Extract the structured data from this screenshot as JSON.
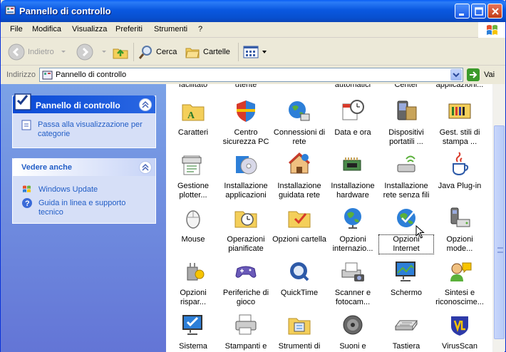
{
  "window": {
    "title": "Pannello di controllo"
  },
  "menu": [
    "File",
    "Modifica",
    "Visualizza",
    "Preferiti",
    "Strumenti",
    "?"
  ],
  "toolbar": {
    "back": "Indietro",
    "search": "Cerca",
    "folders": "Cartelle"
  },
  "address": {
    "label": "Indirizzo",
    "value": "Pannello di controllo",
    "go": "Vai"
  },
  "sidebar": {
    "panel1": {
      "title": "Pannello di controllo",
      "link": "Passa alla visualizzazione per categorie"
    },
    "panel2": {
      "title": "Vedere anche",
      "links": [
        "Windows Update",
        "Guida in linea e supporto tecnico"
      ]
    }
  },
  "partial_row": [
    "facilitato",
    "utente",
    "",
    "automatici",
    "Center",
    "applicazioni..."
  ],
  "items": [
    {
      "label": "Caratteri",
      "icon": "fonts-folder-icon"
    },
    {
      "label": "Centro sicurezza PC",
      "icon": "security-shield-icon"
    },
    {
      "label": "Connessioni di rete",
      "icon": "network-globe-icon"
    },
    {
      "label": "Data e ora",
      "icon": "calendar-clock-icon"
    },
    {
      "label": "Dispositivi portatili ...",
      "icon": "portable-devices-icon"
    },
    {
      "label": "Gest. stili di stampa ...",
      "icon": "print-styles-icon"
    },
    {
      "label": "Gestione plotter...",
      "icon": "plotter-icon"
    },
    {
      "label": "Installazione applicazioni",
      "icon": "install-cd-icon"
    },
    {
      "label": "Installazione guidata rete",
      "icon": "house-network-icon"
    },
    {
      "label": "Installazione hardware",
      "icon": "hardware-icon"
    },
    {
      "label": "Installazione rete senza fili",
      "icon": "wireless-icon"
    },
    {
      "label": "Java Plug-in",
      "icon": "java-cup-icon"
    },
    {
      "label": "Mouse",
      "icon": "mouse-icon"
    },
    {
      "label": "Operazioni pianificate",
      "icon": "scheduled-tasks-icon"
    },
    {
      "label": "Opzioni cartella",
      "icon": "folder-options-icon"
    },
    {
      "label": "Opzioni internazio...",
      "icon": "globe-icon"
    },
    {
      "label": "Opzioni Internet",
      "icon": "internet-options-icon"
    },
    {
      "label": "Opzioni mode...",
      "icon": "modem-icon"
    },
    {
      "label": "Opzioni rispar...",
      "icon": "power-icon"
    },
    {
      "label": "Periferiche di gioco",
      "icon": "gamepad-icon"
    },
    {
      "label": "QuickTime",
      "icon": "quicktime-icon"
    },
    {
      "label": "Scanner e fotocam...",
      "icon": "scanner-icon"
    },
    {
      "label": "Schermo",
      "icon": "display-icon"
    },
    {
      "label": "Sintesi e riconoscime...",
      "icon": "speech-icon"
    },
    {
      "label": "Sistema",
      "icon": "system-icon"
    },
    {
      "label": "Stampanti e",
      "icon": "printer-icon"
    },
    {
      "label": "Strumenti di",
      "icon": "admin-tools-icon"
    },
    {
      "label": "Suoni e",
      "icon": "speaker-icon"
    },
    {
      "label": "Tastiera",
      "icon": "keyboard-icon"
    },
    {
      "label": "VirusScan",
      "icon": "virusscan-icon"
    }
  ],
  "selected_item": "Opzioni Internet"
}
